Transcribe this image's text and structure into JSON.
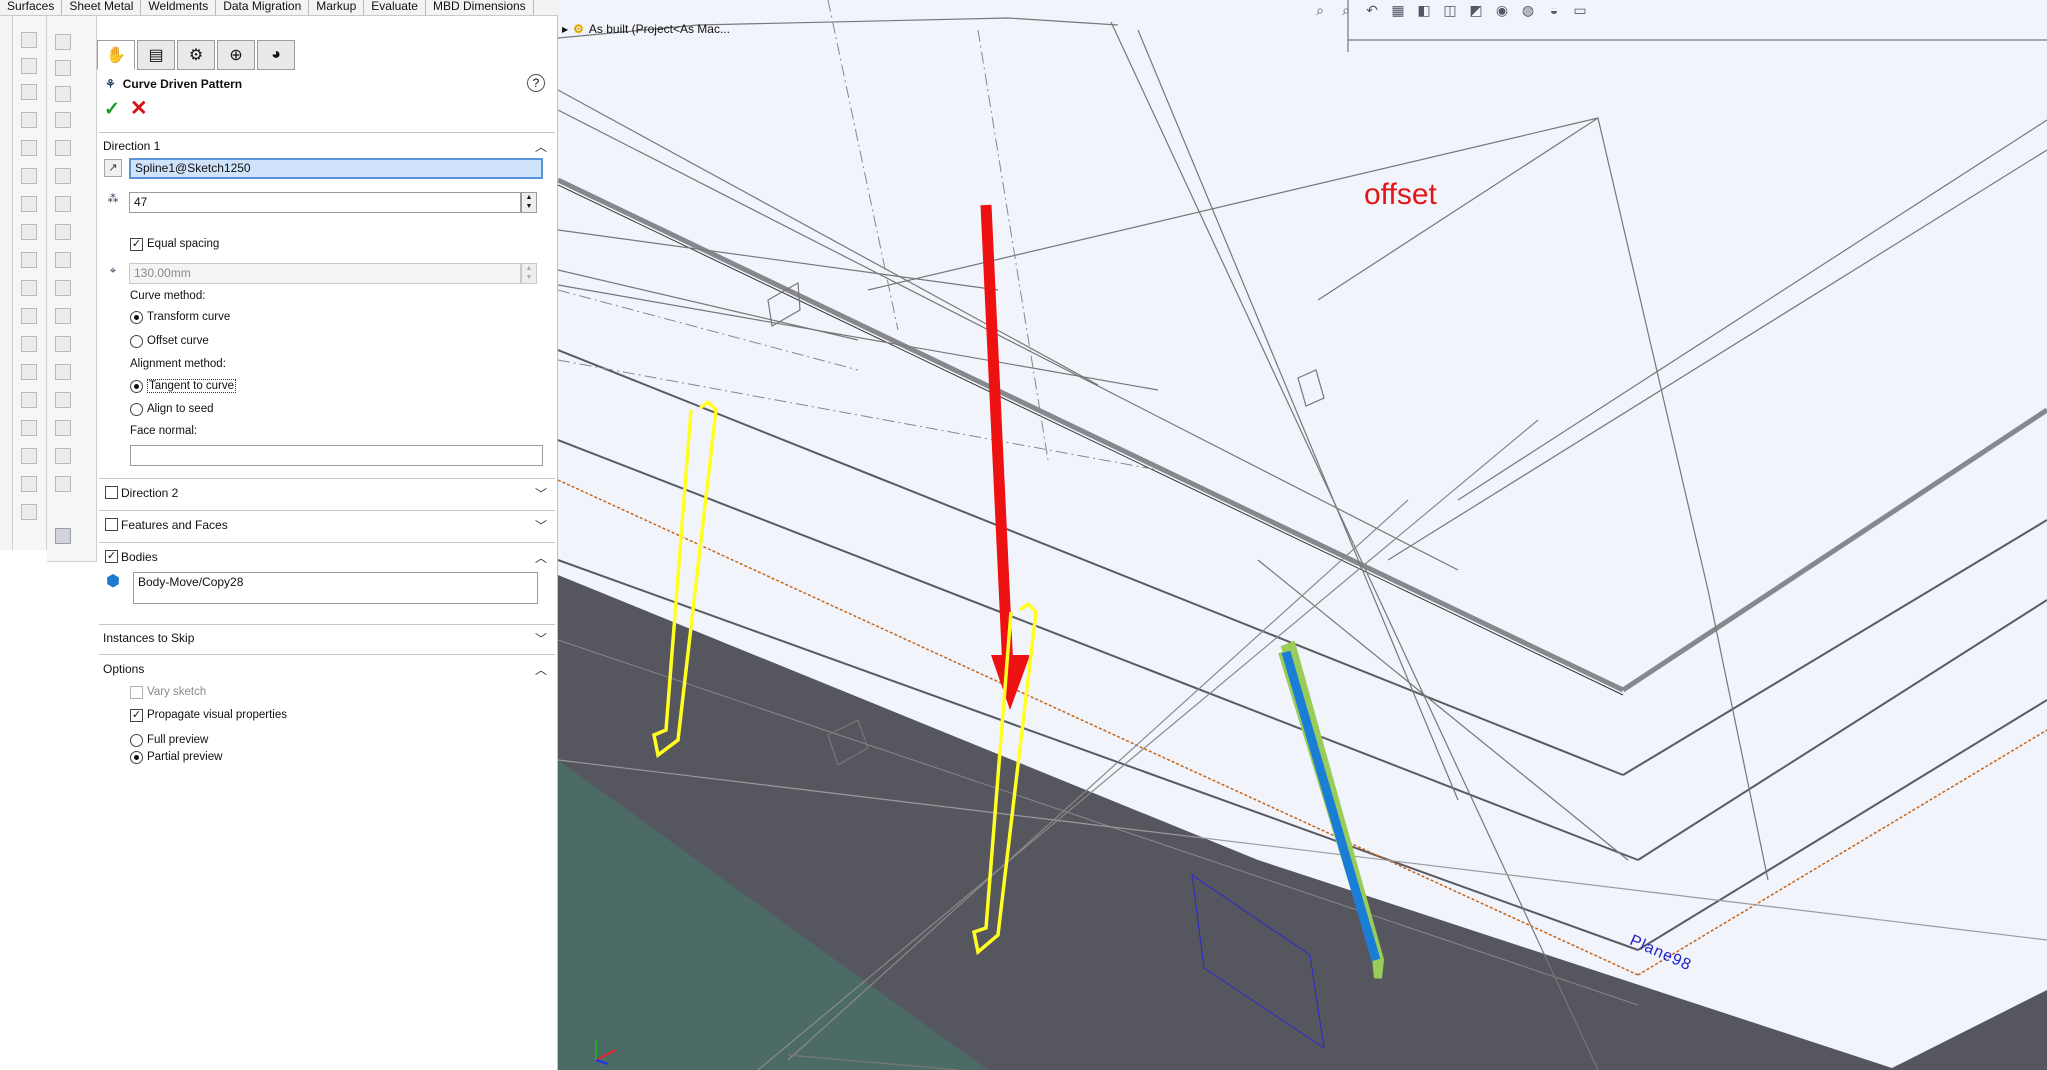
{
  "ribbon": {
    "tabs": [
      "Surfaces",
      "Sheet Metal",
      "Weldments",
      "Data Migration",
      "Markup",
      "Evaluate",
      "MBD Dimensions"
    ]
  },
  "property_manager": {
    "title": "Curve Driven Pattern",
    "help_symbol": "?",
    "ok_symbol": "✓",
    "cancel_symbol": "✕",
    "direction1": {
      "header": "Direction 1",
      "pattern_direction": "Spline1@Sketch1250",
      "instances": "47",
      "equal_spacing": "Equal spacing",
      "spacing": "130.00mm",
      "curve_method_label": "Curve method:",
      "transform_curve": "Transform curve",
      "offset_curve": "Offset curve",
      "alignment_method_label": "Alignment method:",
      "tangent_to_curve": "Tangent to curve",
      "align_to_seed": "Align to seed",
      "face_normal_label": "Face normal:",
      "face_normal_value": ""
    },
    "direction2": {
      "header": "Direction 2"
    },
    "features_and_faces": {
      "header": "Features and Faces"
    },
    "bodies": {
      "header": "Bodies",
      "value": "Body-Move/Copy28"
    },
    "instances_to_skip": {
      "header": "Instances to Skip"
    },
    "options": {
      "header": "Options",
      "vary_sketch": "Vary sketch",
      "propagate_visual": "Propagate visual properties",
      "full_preview": "Full preview",
      "partial_preview": "Partial preview"
    }
  },
  "viewport": {
    "tree_item": "As built (Project<As Mac...",
    "annotation_text": "offset",
    "plane_label": "Plane98",
    "colors": {
      "background": "#f2f4fc",
      "arrow": "#ee1111",
      "seed_highlight": "#ffff22",
      "selected_body": "#1b7ed6",
      "plane": "#2a2ad0",
      "dark_face": "#55565e",
      "green_face": "#4d6b66"
    }
  }
}
